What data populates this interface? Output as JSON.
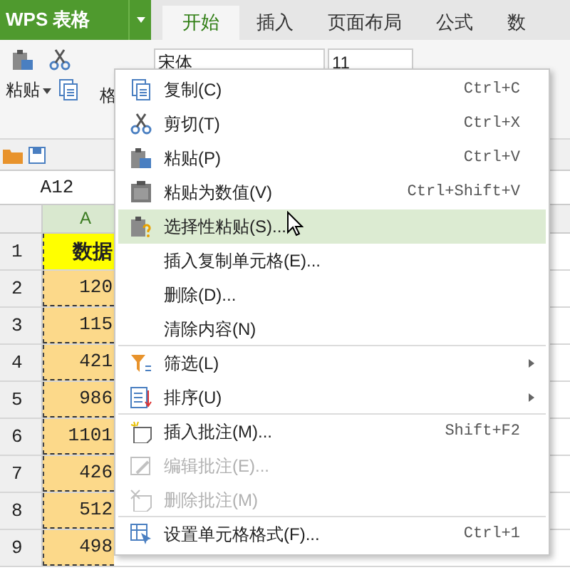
{
  "app": {
    "logo": "WPS 表格"
  },
  "tabs": [
    {
      "label": "开始",
      "selected": true
    },
    {
      "label": "插入",
      "selected": false
    },
    {
      "label": "页面布局",
      "selected": false
    },
    {
      "label": "公式",
      "selected": false
    },
    {
      "label": "数",
      "selected": false
    }
  ],
  "ribbon": {
    "paste": "粘贴",
    "format_painter": "格",
    "font": "宋体",
    "size": "11"
  },
  "name_box": "A12",
  "sheet": {
    "column": "A",
    "rows": [
      {
        "n": "1",
        "value": "数据",
        "kind": "header"
      },
      {
        "n": "2",
        "value": "120",
        "kind": "cell"
      },
      {
        "n": "3",
        "value": "115",
        "kind": "cell"
      },
      {
        "n": "4",
        "value": "421",
        "kind": "cell"
      },
      {
        "n": "5",
        "value": "986",
        "kind": "cell"
      },
      {
        "n": "6",
        "value": "1101",
        "kind": "cell"
      },
      {
        "n": "7",
        "value": "426",
        "kind": "cell"
      },
      {
        "n": "8",
        "value": "512",
        "kind": "cell"
      },
      {
        "n": "9",
        "value": "498",
        "kind": "cell"
      }
    ]
  },
  "context_menu": [
    {
      "label": "复制(C)",
      "shortcut": "Ctrl+C",
      "kind": "copy",
      "selected": false,
      "disabled": false,
      "submenu": false,
      "separator_after": false
    },
    {
      "label": "剪切(T)",
      "shortcut": "Ctrl+X",
      "kind": "cut",
      "selected": false,
      "disabled": false,
      "submenu": false,
      "separator_after": false
    },
    {
      "label": "粘贴(P)",
      "shortcut": "Ctrl+V",
      "kind": "paste",
      "selected": false,
      "disabled": false,
      "submenu": false,
      "separator_after": false
    },
    {
      "label": "粘贴为数值(V)",
      "shortcut": "Ctrl+Shift+V",
      "kind": "values",
      "selected": false,
      "disabled": false,
      "submenu": false,
      "separator_after": false
    },
    {
      "label": "选择性粘贴(S)...",
      "kind": "special",
      "selected": true,
      "disabled": false,
      "submenu": false,
      "separator_after": false
    },
    {
      "label": "插入复制单元格(E)...",
      "selected": false,
      "disabled": false,
      "submenu": false,
      "separator_after": false
    },
    {
      "label": "删除(D)...",
      "selected": false,
      "disabled": false,
      "submenu": false,
      "separator_after": false
    },
    {
      "label": "清除内容(N)",
      "selected": false,
      "disabled": false,
      "submenu": false,
      "separator_after": true
    },
    {
      "label": "筛选(L)",
      "kind": "filter",
      "selected": false,
      "disabled": false,
      "submenu": true,
      "separator_after": false
    },
    {
      "label": "排序(U)",
      "kind": "sort",
      "selected": false,
      "disabled": false,
      "submenu": true,
      "separator_after": true
    },
    {
      "label": "插入批注(M)...",
      "shortcut": "Shift+F2",
      "kind": "note",
      "selected": false,
      "disabled": false,
      "submenu": false,
      "separator_after": false
    },
    {
      "label": "编辑批注(E)...",
      "kind": "edit",
      "selected": false,
      "disabled": true,
      "submenu": false,
      "separator_after": false
    },
    {
      "label": "删除批注(M)",
      "kind": "delnote",
      "selected": false,
      "disabled": true,
      "submenu": false,
      "separator_after": true
    },
    {
      "label": "设置单元格格式(F)...",
      "shortcut": "Ctrl+1",
      "kind": "format",
      "selected": false,
      "disabled": false,
      "submenu": false,
      "separator_after": false
    }
  ]
}
